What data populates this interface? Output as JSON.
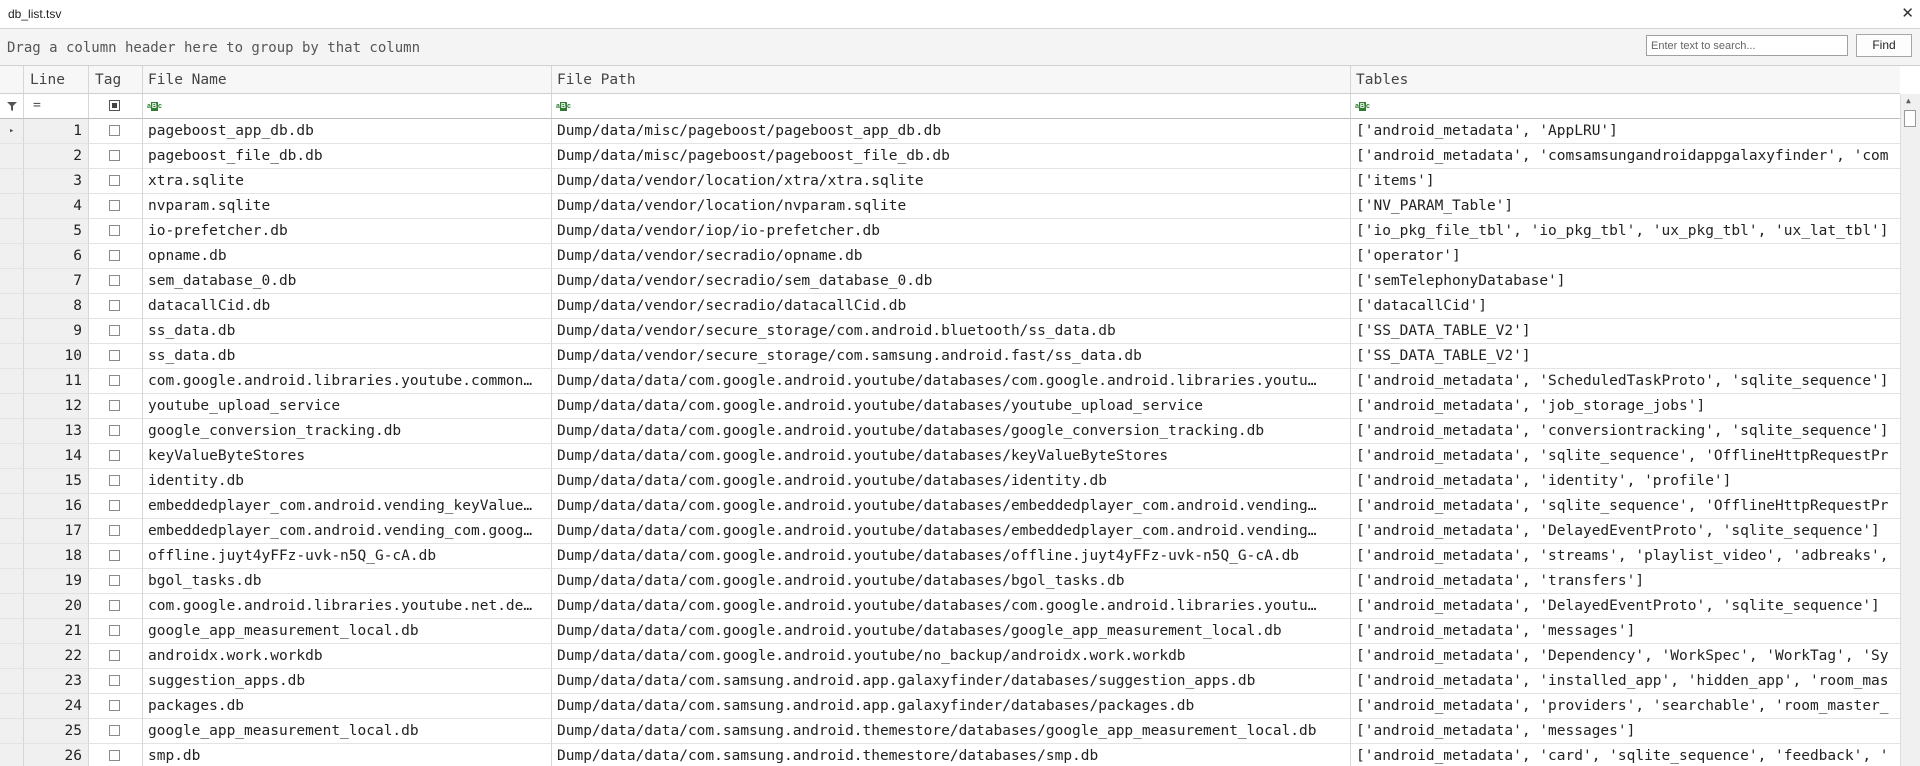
{
  "window": {
    "title": "db_list.tsv",
    "close_glyph": "✕"
  },
  "group_panel": {
    "hint": "Drag a column header here to group by that column"
  },
  "search": {
    "placeholder": "Enter text to search...",
    "find_label": "Find"
  },
  "columns": {
    "line": "Line",
    "tag": "Tag",
    "file_name": "File Name",
    "file_path": "File Path",
    "tables": "Tables"
  },
  "filter_row": {
    "equals_glyph": "=",
    "text_filter_icon": "abc-filter-icon"
  },
  "rows": [
    {
      "line": "1",
      "file_name": "pageboost_app_db.db",
      "file_path": "Dump/data/misc/pageboost/pageboost_app_db.db",
      "tables": "['android_metadata', 'AppLRU']"
    },
    {
      "line": "2",
      "file_name": "pageboost_file_db.db",
      "file_path": "Dump/data/misc/pageboost/pageboost_file_db.db",
      "tables": "['android_metadata', 'comsamsungandroidappgalaxyfinder', 'com"
    },
    {
      "line": "3",
      "file_name": "xtra.sqlite",
      "file_path": "Dump/data/vendor/location/xtra/xtra.sqlite",
      "tables": "['items']"
    },
    {
      "line": "4",
      "file_name": "nvparam.sqlite",
      "file_path": "Dump/data/vendor/location/nvparam.sqlite",
      "tables": "['NV_PARAM_Table']"
    },
    {
      "line": "5",
      "file_name": "io-prefetcher.db",
      "file_path": "Dump/data/vendor/iop/io-prefetcher.db",
      "tables": "['io_pkg_file_tbl', 'io_pkg_tbl', 'ux_pkg_tbl', 'ux_lat_tbl']"
    },
    {
      "line": "6",
      "file_name": "opname.db",
      "file_path": "Dump/data/vendor/secradio/opname.db",
      "tables": "['operator']"
    },
    {
      "line": "7",
      "file_name": "sem_database_0.db",
      "file_path": "Dump/data/vendor/secradio/sem_database_0.db",
      "tables": "['semTelephonyDatabase']"
    },
    {
      "line": "8",
      "file_name": "datacallCid.db",
      "file_path": "Dump/data/vendor/secradio/datacallCid.db",
      "tables": "['datacallCid']"
    },
    {
      "line": "9",
      "file_name": "ss_data.db",
      "file_path": "Dump/data/vendor/secure_storage/com.android.bluetooth/ss_data.db",
      "tables": "['SS_DATA_TABLE_V2']"
    },
    {
      "line": "10",
      "file_name": "ss_data.db",
      "file_path": "Dump/data/vendor/secure_storage/com.samsung.android.fast/ss_data.db",
      "tables": "['SS_DATA_TABLE_V2']"
    },
    {
      "line": "11",
      "file_name": "com.google.android.libraries.youtube.common…",
      "file_path": "Dump/data/data/com.google.android.youtube/databases/com.google.android.libraries.youtu…",
      "tables": "['android_metadata', 'ScheduledTaskProto', 'sqlite_sequence']"
    },
    {
      "line": "12",
      "file_name": "youtube_upload_service",
      "file_path": "Dump/data/data/com.google.android.youtube/databases/youtube_upload_service",
      "tables": "['android_metadata', 'job_storage_jobs']"
    },
    {
      "line": "13",
      "file_name": "google_conversion_tracking.db",
      "file_path": "Dump/data/data/com.google.android.youtube/databases/google_conversion_tracking.db",
      "tables": "['android_metadata', 'conversiontracking', 'sqlite_sequence']"
    },
    {
      "line": "14",
      "file_name": "keyValueByteStores",
      "file_path": "Dump/data/data/com.google.android.youtube/databases/keyValueByteStores",
      "tables": "['android_metadata', 'sqlite_sequence', 'OfflineHttpRequestPr"
    },
    {
      "line": "15",
      "file_name": "identity.db",
      "file_path": "Dump/data/data/com.google.android.youtube/databases/identity.db",
      "tables": "['android_metadata', 'identity', 'profile']"
    },
    {
      "line": "16",
      "file_name": "embeddedplayer_com.android.vending_keyValue…",
      "file_path": "Dump/data/data/com.google.android.youtube/databases/embeddedplayer_com.android.vending…",
      "tables": "['android_metadata', 'sqlite_sequence', 'OfflineHttpRequestPr"
    },
    {
      "line": "17",
      "file_name": "embeddedplayer_com.android.vending_com.goog…",
      "file_path": "Dump/data/data/com.google.android.youtube/databases/embeddedplayer_com.android.vending…",
      "tables": "['android_metadata', 'DelayedEventProto', 'sqlite_sequence']"
    },
    {
      "line": "18",
      "file_name": "offline.juyt4yFFz-uvk-n5Q_G-cA.db",
      "file_path": "Dump/data/data/com.google.android.youtube/databases/offline.juyt4yFFz-uvk-n5Q_G-cA.db",
      "tables": "['android_metadata', 'streams', 'playlist_video', 'adbreaks',"
    },
    {
      "line": "19",
      "file_name": "bgol_tasks.db",
      "file_path": "Dump/data/data/com.google.android.youtube/databases/bgol_tasks.db",
      "tables": "['android_metadata', 'transfers']"
    },
    {
      "line": "20",
      "file_name": "com.google.android.libraries.youtube.net.de…",
      "file_path": "Dump/data/data/com.google.android.youtube/databases/com.google.android.libraries.youtu…",
      "tables": "['android_metadata', 'DelayedEventProto', 'sqlite_sequence']"
    },
    {
      "line": "21",
      "file_name": "google_app_measurement_local.db",
      "file_path": "Dump/data/data/com.google.android.youtube/databases/google_app_measurement_local.db",
      "tables": "['android_metadata', 'messages']"
    },
    {
      "line": "22",
      "file_name": "androidx.work.workdb",
      "file_path": "Dump/data/data/com.google.android.youtube/no_backup/androidx.work.workdb",
      "tables": "['android_metadata', 'Dependency', 'WorkSpec', 'WorkTag', 'Sy"
    },
    {
      "line": "23",
      "file_name": "suggestion_apps.db",
      "file_path": "Dump/data/data/com.samsung.android.app.galaxyfinder/databases/suggestion_apps.db",
      "tables": "['android_metadata', 'installed_app', 'hidden_app', 'room_mas"
    },
    {
      "line": "24",
      "file_name": "packages.db",
      "file_path": "Dump/data/data/com.samsung.android.app.galaxyfinder/databases/packages.db",
      "tables": "['android_metadata', 'providers', 'searchable', 'room_master_"
    },
    {
      "line": "25",
      "file_name": "google_app_measurement_local.db",
      "file_path": "Dump/data/data/com.samsung.android.themestore/databases/google_app_measurement_local.db",
      "tables": "['android_metadata', 'messages']"
    },
    {
      "line": "26",
      "file_name": "smp.db",
      "file_path": "Dump/data/data/com.samsung.android.themestore/databases/smp.db",
      "tables": "['android_metadata', 'card', 'sqlite_sequence', 'feedback', '"
    }
  ]
}
